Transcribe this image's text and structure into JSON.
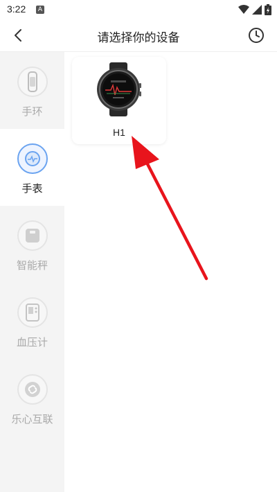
{
  "status_bar": {
    "time": "3:22",
    "notification_icon": "A"
  },
  "header": {
    "title": "请选择你的设备",
    "back_icon": "chevron-left",
    "history_icon": "clock"
  },
  "sidebar": {
    "items": [
      {
        "label": "手环",
        "icon": "band-icon",
        "active": false
      },
      {
        "label": "手表",
        "icon": "watch-icon",
        "active": true
      },
      {
        "label": "智能秤",
        "icon": "scale-icon",
        "active": false
      },
      {
        "label": "血压计",
        "icon": "blood-pressure-icon",
        "active": false
      },
      {
        "label": "乐心互联",
        "icon": "link-icon",
        "active": false
      }
    ]
  },
  "devices": [
    {
      "name": "H1",
      "image": "smartwatch"
    }
  ],
  "colors": {
    "accent": "#6aa3f0",
    "arrow": "#e8141c",
    "sidebar_bg": "#f4f4f4"
  }
}
